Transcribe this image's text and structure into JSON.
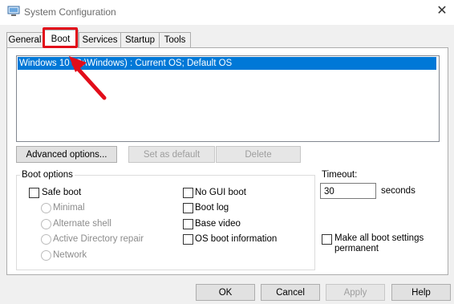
{
  "window": {
    "title": "System Configuration"
  },
  "tabs": [
    {
      "label": "General"
    },
    {
      "label": "Boot"
    },
    {
      "label": "Services"
    },
    {
      "label": "Startup"
    },
    {
      "label": "Tools"
    }
  ],
  "os_list": {
    "entry": "Windows 10 (C:\\Windows) : Current OS; Default OS"
  },
  "buttons": {
    "advanced": "Advanced options...",
    "set_default": "Set as default",
    "delete": "Delete",
    "ok": "OK",
    "cancel": "Cancel",
    "apply": "Apply",
    "help": "Help"
  },
  "boot_options": {
    "legend": "Boot options",
    "safe_boot": "Safe boot",
    "minimal": "Minimal",
    "alternate_shell": "Alternate shell",
    "active_directory_repair": "Active Directory repair",
    "network": "Network",
    "no_gui_boot": "No GUI boot",
    "boot_log": "Boot log",
    "base_video": "Base video",
    "os_boot_information": "OS boot information"
  },
  "timeout": {
    "label": "Timeout:",
    "value": "30",
    "unit": "seconds"
  },
  "persist": {
    "label_line1": "Make all boot settings",
    "label_line2": "permanent"
  },
  "colors": {
    "selection": "#0078d7",
    "annotation": "#e20d1a"
  }
}
